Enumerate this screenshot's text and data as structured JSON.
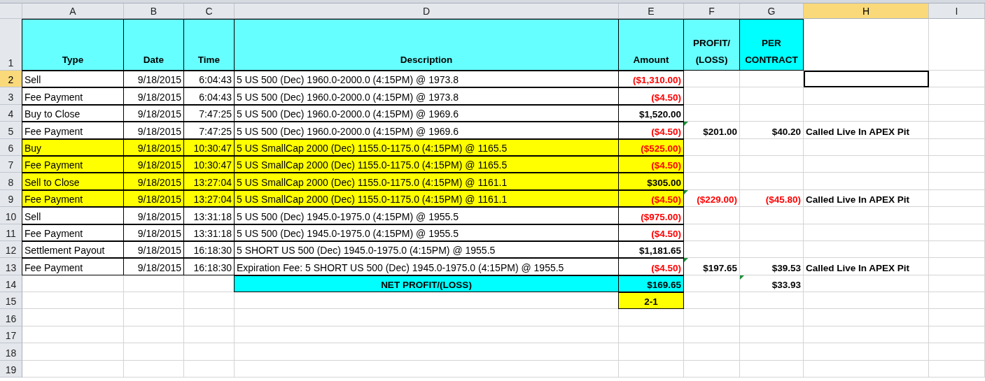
{
  "columns": [
    {
      "label": "A",
      "selected": false
    },
    {
      "label": "B",
      "selected": false
    },
    {
      "label": "C",
      "selected": false
    },
    {
      "label": "D",
      "selected": false
    },
    {
      "label": "E",
      "selected": false
    },
    {
      "label": "F",
      "selected": false
    },
    {
      "label": "G",
      "selected": false
    },
    {
      "label": "H",
      "selected": true
    },
    {
      "label": "I",
      "selected": false
    }
  ],
  "rows": [
    {
      "n": "1",
      "selected": false,
      "cells": {
        "A": {
          "t": "Type",
          "kind": "heading",
          "color": "#66ffff"
        },
        "B": {
          "t": "Date",
          "kind": "heading",
          "color": "#66ffff"
        },
        "C": {
          "t": "Time",
          "kind": "heading",
          "color": "#66ffff"
        },
        "D": {
          "t": "Description",
          "kind": "heading",
          "color": "#66ffff"
        },
        "E": {
          "t": "Amount",
          "kind": "heading",
          "color": "#66ffff"
        },
        "F": {
          "t": "PROFIT/ (LOSS)",
          "kind": "heading",
          "color": "#66ffff"
        },
        "G": {
          "t": "PER CONTRACT",
          "kind": "heading",
          "color": "#00ffff"
        }
      }
    },
    {
      "n": "2",
      "selected": true,
      "cells": {
        "A": {
          "t": "Sell",
          "kind": "text"
        },
        "B": {
          "t": "9/18/2015",
          "kind": "date"
        },
        "C": {
          "t": "6:04:43",
          "kind": "date"
        },
        "D": {
          "t": "5 US 500 (Dec) 1960.0-2000.0 (4:15PM) @ 1973.8",
          "kind": "text"
        },
        "E": {
          "t": "($1,310.00)",
          "kind": "amount",
          "negative": true
        }
      }
    },
    {
      "n": "3",
      "selected": false,
      "cells": {
        "A": {
          "t": "Fee Payment",
          "kind": "text"
        },
        "B": {
          "t": "9/18/2015",
          "kind": "date"
        },
        "C": {
          "t": "6:04:43",
          "kind": "date"
        },
        "D": {
          "t": "5 US 500 (Dec) 1960.0-2000.0 (4:15PM) @ 1973.8",
          "kind": "text"
        },
        "E": {
          "t": "($4.50)",
          "kind": "amount",
          "negative": true
        }
      }
    },
    {
      "n": "4",
      "selected": false,
      "cells": {
        "A": {
          "t": "Buy to Close",
          "kind": "text"
        },
        "B": {
          "t": "9/18/2015",
          "kind": "date"
        },
        "C": {
          "t": "7:47:25",
          "kind": "date"
        },
        "D": {
          "t": "5 US 500 (Dec) 1960.0-2000.0 (4:15PM) @ 1969.6",
          "kind": "text"
        },
        "E": {
          "t": "$1,520.00",
          "kind": "amount",
          "negative": false
        }
      }
    },
    {
      "n": "5",
      "selected": false,
      "cells": {
        "A": {
          "t": "Fee Payment",
          "kind": "text"
        },
        "B": {
          "t": "9/18/2015",
          "kind": "date"
        },
        "C": {
          "t": "7:47:25",
          "kind": "date"
        },
        "D": {
          "t": "5 US 500 (Dec) 1960.0-2000.0 (4:15PM) @ 1969.6",
          "kind": "text"
        },
        "E": {
          "t": "($4.50)",
          "kind": "amount",
          "negative": true
        },
        "F": {
          "t": "$201.00",
          "kind": "amount",
          "negative": false,
          "flag": true
        },
        "G": {
          "t": "$40.20",
          "kind": "amount",
          "negative": false
        },
        "H": {
          "t": "Called Live In APEX Pit",
          "kind": "note"
        }
      }
    },
    {
      "n": "6",
      "selected": false,
      "cells": {
        "A": {
          "t": "Buy",
          "kind": "text",
          "color": "#ffff00"
        },
        "B": {
          "t": "9/18/2015",
          "kind": "date",
          "color": "#ffff00"
        },
        "C": {
          "t": "10:30:47",
          "kind": "date",
          "color": "#ffff00"
        },
        "D": {
          "t": "5 US SmallCap 2000 (Dec) 1155.0-1175.0 (4:15PM) @ 1165.5",
          "kind": "text",
          "color": "#ffff00"
        },
        "E": {
          "t": "($525.00)",
          "kind": "amount",
          "negative": true,
          "color": "#ffff00"
        }
      }
    },
    {
      "n": "7",
      "selected": false,
      "cells": {
        "A": {
          "t": "Fee Payment",
          "kind": "text",
          "color": "#ffff00"
        },
        "B": {
          "t": "9/18/2015",
          "kind": "date",
          "color": "#ffff00"
        },
        "C": {
          "t": "10:30:47",
          "kind": "date",
          "color": "#ffff00"
        },
        "D": {
          "t": "5 US SmallCap 2000 (Dec) 1155.0-1175.0 (4:15PM) @ 1165.5",
          "kind": "text",
          "color": "#ffff00"
        },
        "E": {
          "t": "($4.50)",
          "kind": "amount",
          "negative": true,
          "color": "#ffff00"
        }
      }
    },
    {
      "n": "8",
      "selected": false,
      "cells": {
        "A": {
          "t": "Sell to Close",
          "kind": "text",
          "color": "#ffff00"
        },
        "B": {
          "t": "9/18/2015",
          "kind": "date",
          "color": "#ffff00"
        },
        "C": {
          "t": "13:27:04",
          "kind": "date",
          "color": "#ffff00"
        },
        "D": {
          "t": "5 US SmallCap 2000 (Dec) 1155.0-1175.0 (4:15PM) @ 1161.1",
          "kind": "text",
          "color": "#ffff00"
        },
        "E": {
          "t": "$305.00",
          "kind": "amount",
          "negative": false,
          "color": "#ffff00"
        }
      }
    },
    {
      "n": "9",
      "selected": false,
      "cells": {
        "A": {
          "t": "Fee Payment",
          "kind": "text",
          "color": "#ffff00"
        },
        "B": {
          "t": "9/18/2015",
          "kind": "date",
          "color": "#ffff00"
        },
        "C": {
          "t": "13:27:04",
          "kind": "date",
          "color": "#ffff00"
        },
        "D": {
          "t": "5 US SmallCap 2000 (Dec) 1155.0-1175.0 (4:15PM) @ 1161.1",
          "kind": "text",
          "color": "#ffff00"
        },
        "E": {
          "t": "($4.50)",
          "kind": "amount",
          "negative": true,
          "color": "#ffff00"
        },
        "F": {
          "t": "($229.00)",
          "kind": "amount",
          "negative": true,
          "flag": true
        },
        "G": {
          "t": "($45.80)",
          "kind": "amount",
          "negative": true
        },
        "H": {
          "t": "Called Live In APEX Pit",
          "kind": "note"
        }
      }
    },
    {
      "n": "10",
      "selected": false,
      "cells": {
        "A": {
          "t": "Sell",
          "kind": "text"
        },
        "B": {
          "t": "9/18/2015",
          "kind": "date"
        },
        "C": {
          "t": "13:31:18",
          "kind": "date"
        },
        "D": {
          "t": "5 US 500 (Dec) 1945.0-1975.0 (4:15PM) @ 1955.5",
          "kind": "text"
        },
        "E": {
          "t": "($975.00)",
          "kind": "amount",
          "negative": true
        }
      }
    },
    {
      "n": "11",
      "selected": false,
      "cells": {
        "A": {
          "t": "Fee Payment",
          "kind": "text"
        },
        "B": {
          "t": "9/18/2015",
          "kind": "date"
        },
        "C": {
          "t": "13:31:18",
          "kind": "date"
        },
        "D": {
          "t": "5 US 500 (Dec) 1945.0-1975.0 (4:15PM) @ 1955.5",
          "kind": "text"
        },
        "E": {
          "t": "($4.50)",
          "kind": "amount",
          "negative": true
        }
      }
    },
    {
      "n": "12",
      "selected": false,
      "cells": {
        "A": {
          "t": "Settlement Payout",
          "kind": "text"
        },
        "B": {
          "t": "9/18/2015",
          "kind": "date"
        },
        "C": {
          "t": "16:18:30",
          "kind": "date"
        },
        "D": {
          "t": "5 SHORT US 500 (Dec) 1945.0-1975.0 (4:15PM) @ 1955.5",
          "kind": "text"
        },
        "E": {
          "t": "$1,181.65",
          "kind": "amount",
          "negative": false
        }
      }
    },
    {
      "n": "13",
      "selected": false,
      "cells": {
        "A": {
          "t": "Fee Payment",
          "kind": "text"
        },
        "B": {
          "t": "9/18/2015",
          "kind": "date"
        },
        "C": {
          "t": "16:18:30",
          "kind": "date"
        },
        "D": {
          "t": "Expiration Fee: 5 SHORT US 500 (Dec) 1945.0-1975.0 (4:15PM) @ 1955.5",
          "kind": "text"
        },
        "E": {
          "t": "($4.50)",
          "kind": "amount",
          "negative": true
        },
        "F": {
          "t": "$197.65",
          "kind": "amount",
          "negative": false,
          "flag": true
        },
        "G": {
          "t": "$39.53",
          "kind": "amount",
          "negative": false
        },
        "H": {
          "t": "Called Live In APEX Pit",
          "kind": "note"
        }
      }
    },
    {
      "n": "14",
      "selected": false,
      "cells": {
        "D": {
          "t": "NET PROFIT/(LOSS)",
          "kind": "heading",
          "color": "#00ffff"
        },
        "E": {
          "t": "$169.65",
          "kind": "amount",
          "negative": false,
          "color": "#00ffff"
        },
        "G": {
          "t": "$33.93",
          "kind": "amount",
          "negative": false,
          "flag": true
        }
      }
    },
    {
      "n": "15",
      "selected": false,
      "cells": {
        "E": {
          "t": "2-1",
          "kind": "heading",
          "color": "#ffff00"
        }
      }
    },
    {
      "n": "16",
      "selected": false
    },
    {
      "n": "17",
      "selected": false
    },
    {
      "n": "18",
      "selected": false
    },
    {
      "n": "19",
      "selected": false
    }
  ]
}
